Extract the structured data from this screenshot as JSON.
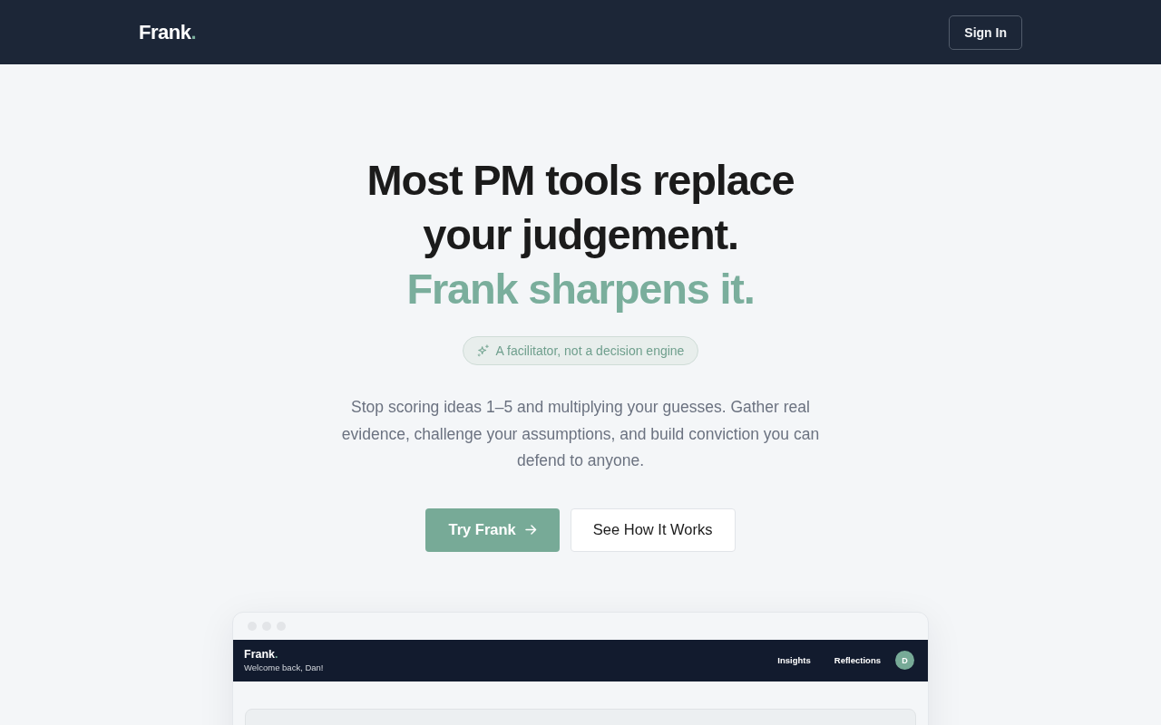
{
  "nav": {
    "logo": "Frank",
    "logo_mark": ".",
    "sign_in": "Sign In"
  },
  "hero": {
    "headline": "Most PM tools replace your judgement.",
    "headline_accent": "Frank sharpens it.",
    "badge": "A facilitator, not a decision engine",
    "description": "Stop scoring ideas 1–5 and multiplying your guesses. Gather real evidence, challenge your assumptions, and build conviction you can defend to anyone.",
    "buttons": [
      {
        "label": "Try Frank",
        "kind": "primary"
      },
      {
        "label": "See How It Works",
        "kind": "secondary"
      }
    ]
  },
  "preview": {
    "app_bar": {
      "logo": "Frank",
      "logo_mark": ".",
      "greeting": "Welcome back, Dan!",
      "links": [
        "Insights",
        "Reflections"
      ],
      "avatar": "D"
    }
  }
}
